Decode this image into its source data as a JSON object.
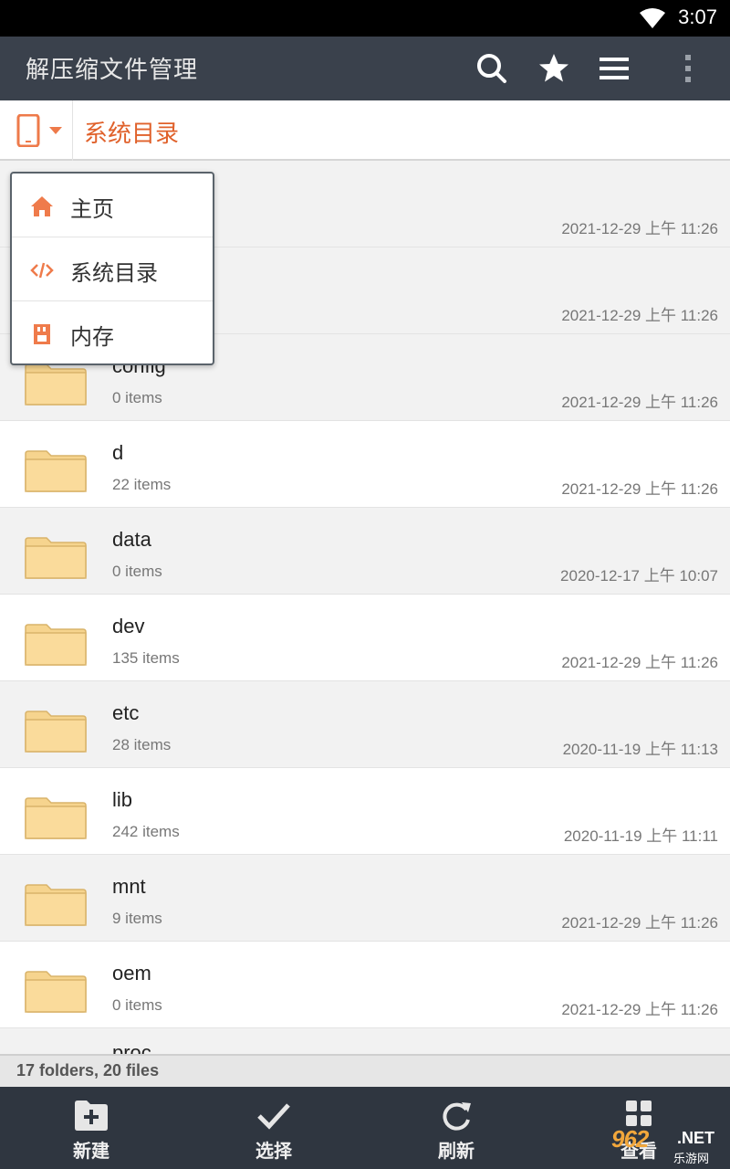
{
  "status_bar": {
    "time": "3:07",
    "wifi_icon": "wifi-icon"
  },
  "app_bar": {
    "title": "解压缩文件管理",
    "actions": [
      "search-icon",
      "star-icon",
      "menu-lines-icon",
      "overflow-dots-icon"
    ]
  },
  "path_bar": {
    "storage_icon": "phone-icon",
    "path": "系统目录"
  },
  "dropdown": {
    "items": [
      {
        "label": "主页",
        "icon": "home-icon"
      },
      {
        "label": "系统目录",
        "icon": "code-icon"
      },
      {
        "label": "内存",
        "icon": "sd-card-icon"
      }
    ]
  },
  "files": [
    {
      "name": "",
      "count": "",
      "date": "2021-12-29 上午 11:26"
    },
    {
      "name": "",
      "count": "",
      "date": "2021-12-29 上午 11:26"
    },
    {
      "name": "config",
      "count": "0 items",
      "date": "2021-12-29 上午 11:26"
    },
    {
      "name": "d",
      "count": "22 items",
      "date": "2021-12-29 上午 11:26"
    },
    {
      "name": "data",
      "count": "0 items",
      "date": "2020-12-17 上午 10:07"
    },
    {
      "name": "dev",
      "count": "135 items",
      "date": "2021-12-29 上午 11:26"
    },
    {
      "name": "etc",
      "count": "28 items",
      "date": "2020-11-19 上午 11:13"
    },
    {
      "name": "lib",
      "count": "242 items",
      "date": "2020-11-19 上午 11:11"
    },
    {
      "name": "mnt",
      "count": "9 items",
      "date": "2021-12-29 上午 11:26"
    },
    {
      "name": "oem",
      "count": "0 items",
      "date": "2021-12-29 上午 11:26"
    },
    {
      "name": "proc",
      "count": "",
      "date": ""
    }
  ],
  "summary": "17 folders, 20 files",
  "bottom_bar": {
    "items": [
      {
        "label": "新建",
        "icon": "new-folder-icon"
      },
      {
        "label": "选择",
        "icon": "check-icon"
      },
      {
        "label": "刷新",
        "icon": "refresh-icon"
      },
      {
        "label": "查看",
        "icon": "grid-icon"
      }
    ]
  },
  "watermark": {
    "number": "962",
    "suffix": ".NET",
    "text": "乐游网"
  },
  "colors": {
    "accent": "#e0612b",
    "app_bar": "#3a414c",
    "bottom_bar": "#2f3640",
    "folder": "#f6d48e"
  }
}
